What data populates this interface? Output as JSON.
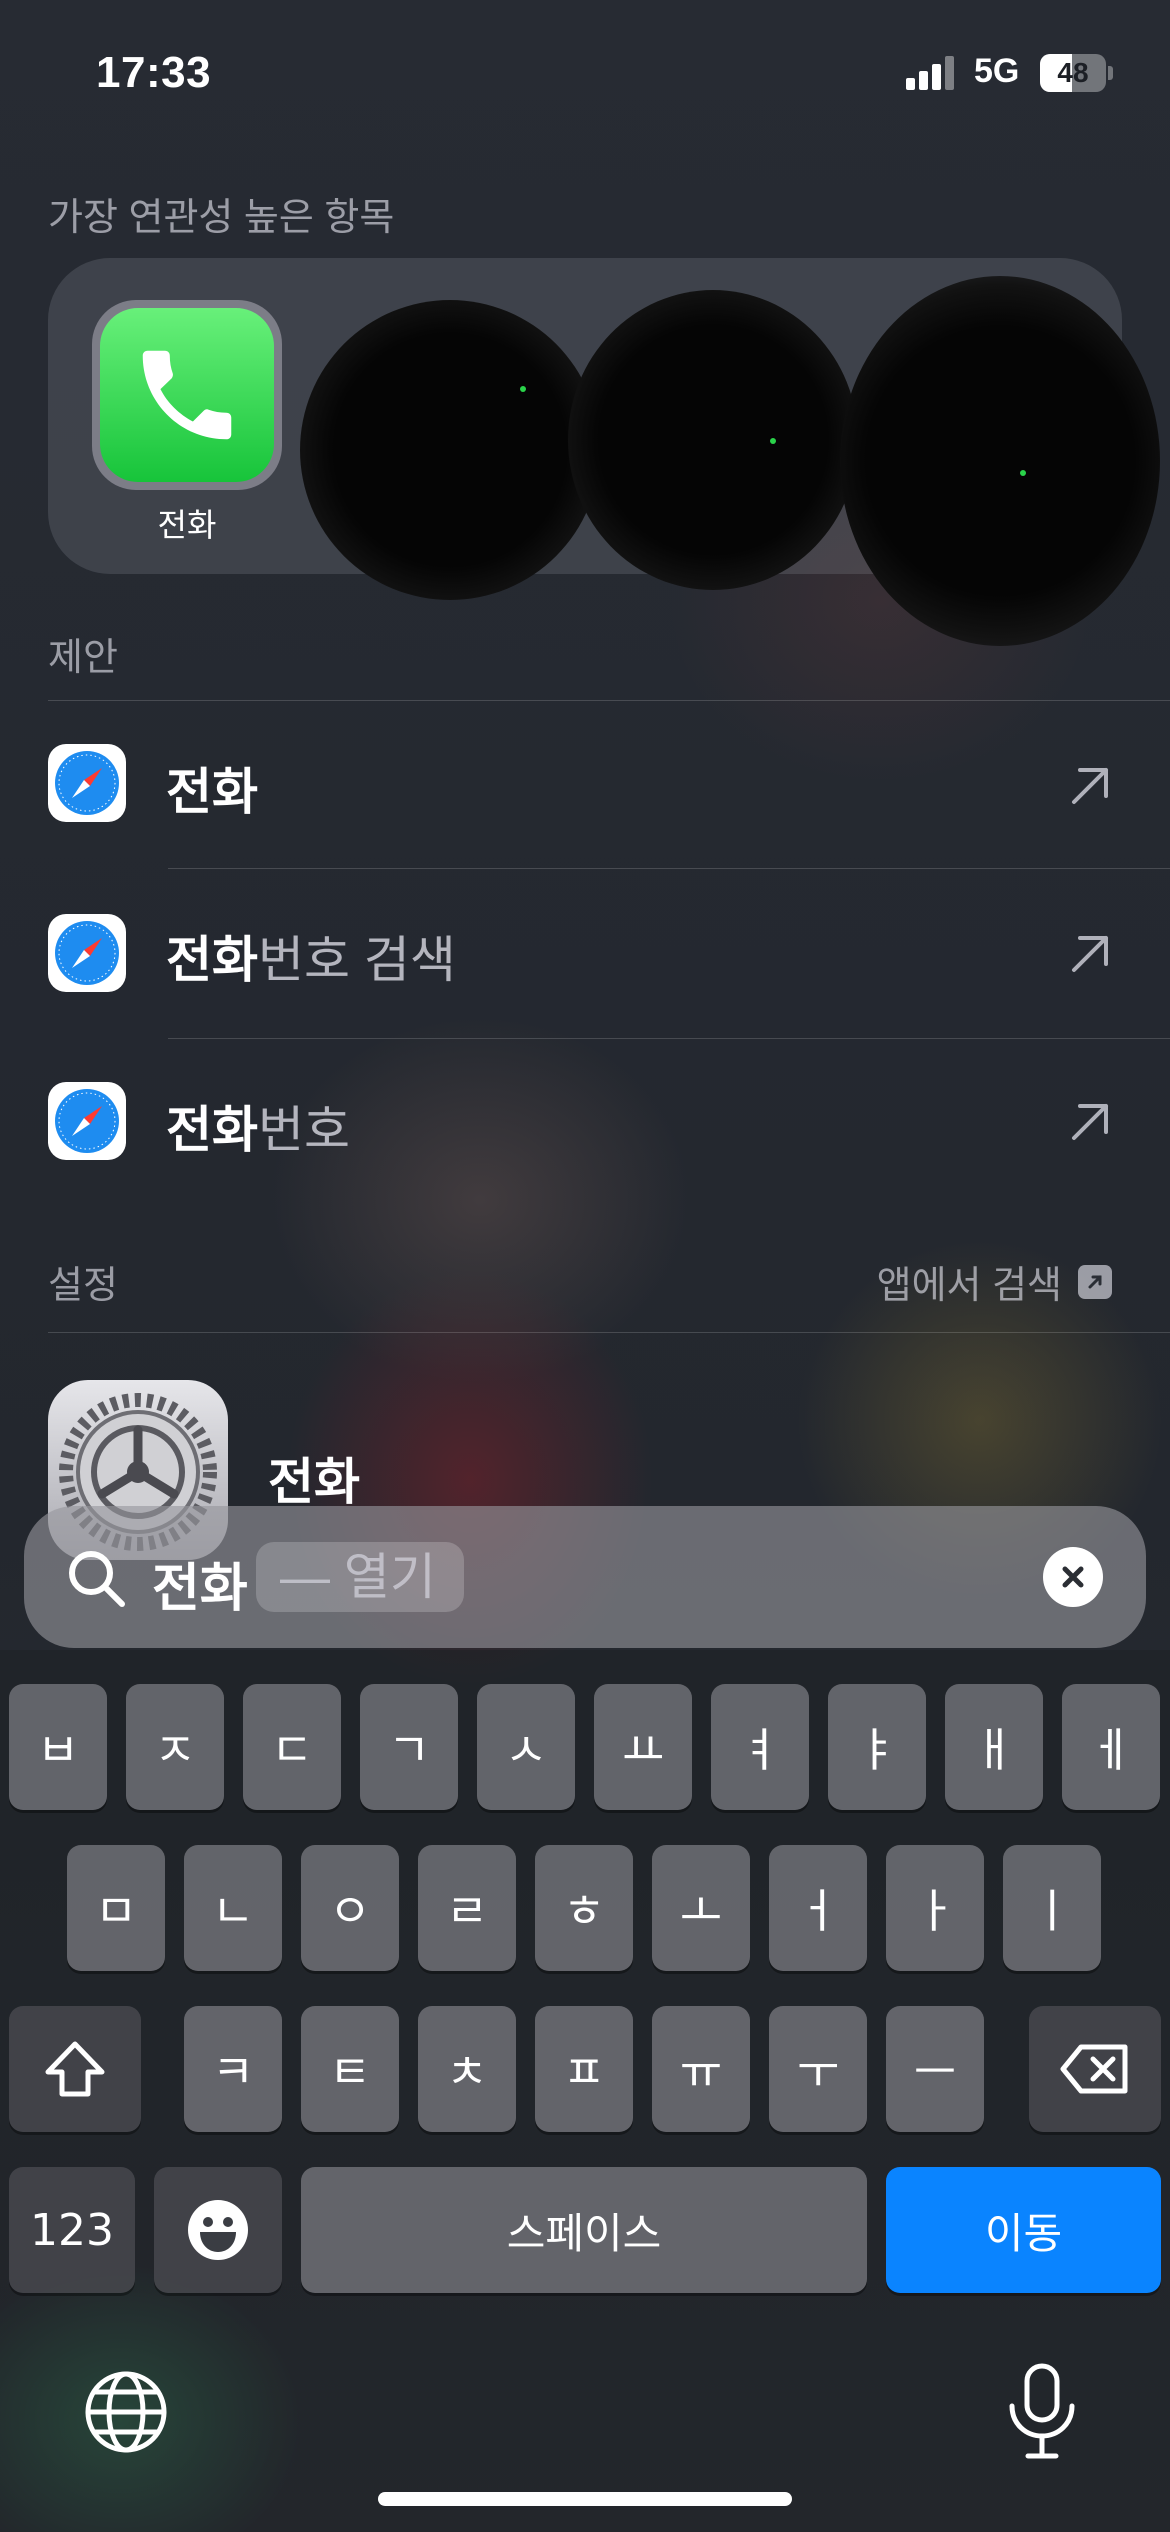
{
  "status_bar": {
    "time": "17:33",
    "network": "5G",
    "battery": "48",
    "battery_level": 0.48
  },
  "top_hits": {
    "header": "가장 연관성 높은 항목",
    "app_label": "전화"
  },
  "suggestions": {
    "header": "제안",
    "items": [
      {
        "bold": "전화",
        "rest": ""
      },
      {
        "bold": "전화",
        "rest": "번호 검색"
      },
      {
        "bold": "전화",
        "rest": "번호"
      }
    ]
  },
  "settings": {
    "header": "설정",
    "search_in_app": "앱에서 검색",
    "item_label": "전화"
  },
  "search": {
    "query": "전화",
    "completion": "— 열기"
  },
  "keyboard": {
    "row1": [
      "ㅂ",
      "ㅈ",
      "ㄷ",
      "ㄱ",
      "ㅅ",
      "ㅛ",
      "ㅕ",
      "ㅑ",
      "ㅐ",
      "ㅔ"
    ],
    "row2": [
      "ㅁ",
      "ㄴ",
      "ㅇ",
      "ㄹ",
      "ㅎ",
      "ㅗ",
      "ㅓ",
      "ㅏ",
      "ㅣ"
    ],
    "row3": [
      "ㅋ",
      "ㅌ",
      "ㅊ",
      "ㅍ",
      "ㅠ",
      "ㅜ",
      "ㅡ"
    ],
    "numbers": "123",
    "space": "스페이스",
    "go": "이동",
    "accent_blue": "#0a84ff"
  }
}
